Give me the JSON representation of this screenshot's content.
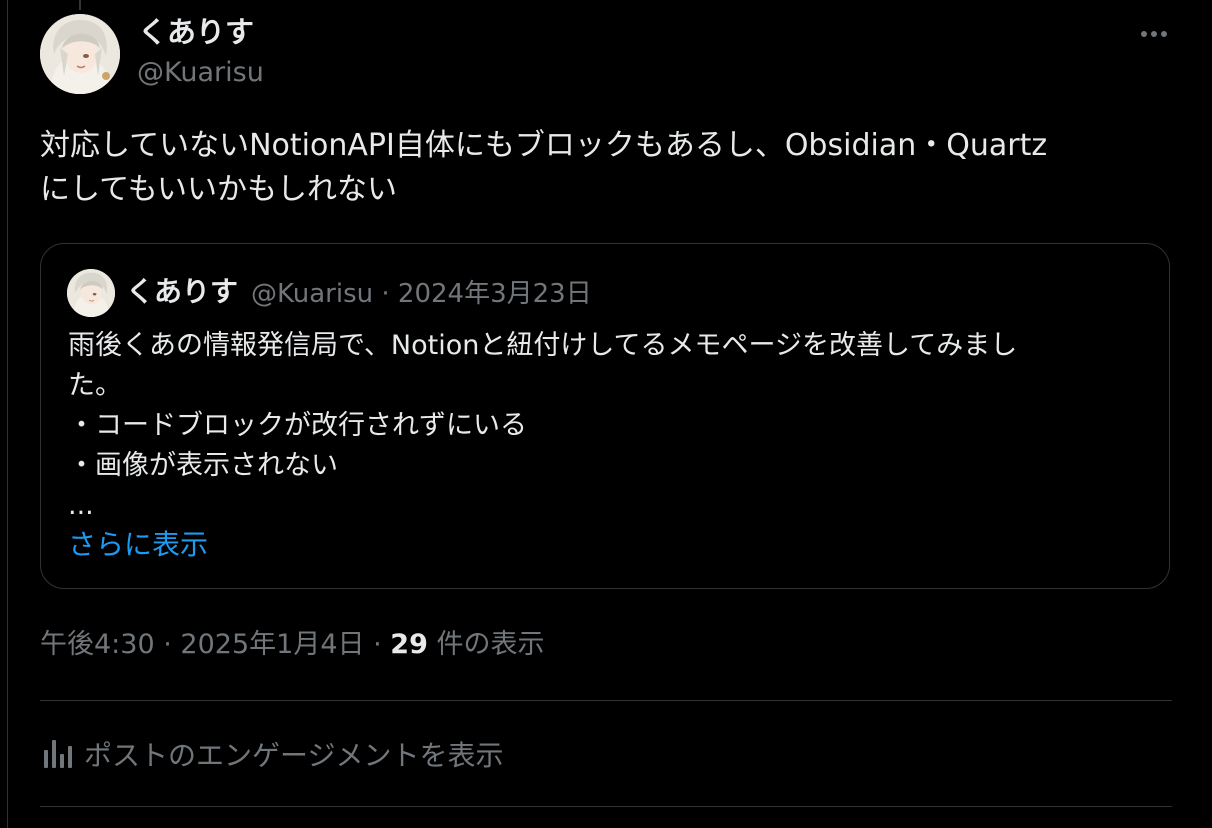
{
  "post": {
    "author_name": "くありす",
    "author_handle": "@Kuarisu",
    "text_lines": [
      "対応していないNotionAPI自体にもブロックもあるし、Obsidian・Quartz",
      "にしてもいいかもしれない"
    ],
    "time": "午後4:30",
    "date": "2025年1月4日",
    "separator": "·",
    "views_count": "29",
    "views_label": "件の表示"
  },
  "quote": {
    "author_name": "くありす",
    "author_handle": "@Kuarisu",
    "date": "2024年3月23日",
    "separator": "·",
    "lines": [
      "雨後くあの情報発信局で、Notionと紐付けしてるメモページを改善してみまし",
      "た。",
      "・コードブロックが改行されずにいる",
      "・画像が表示されない",
      "..."
    ],
    "show_more": "さらに表示"
  },
  "engagement": {
    "label": "ポストのエンゲージメントを表示",
    "icon": "analytics-bars-icon"
  },
  "icons": {
    "more": "more-options-icon"
  },
  "colors": {
    "background": "#000000",
    "text": "#e7e9ea",
    "secondary": "#71767b",
    "link": "#1d9bf0",
    "border": "#2f3336"
  }
}
